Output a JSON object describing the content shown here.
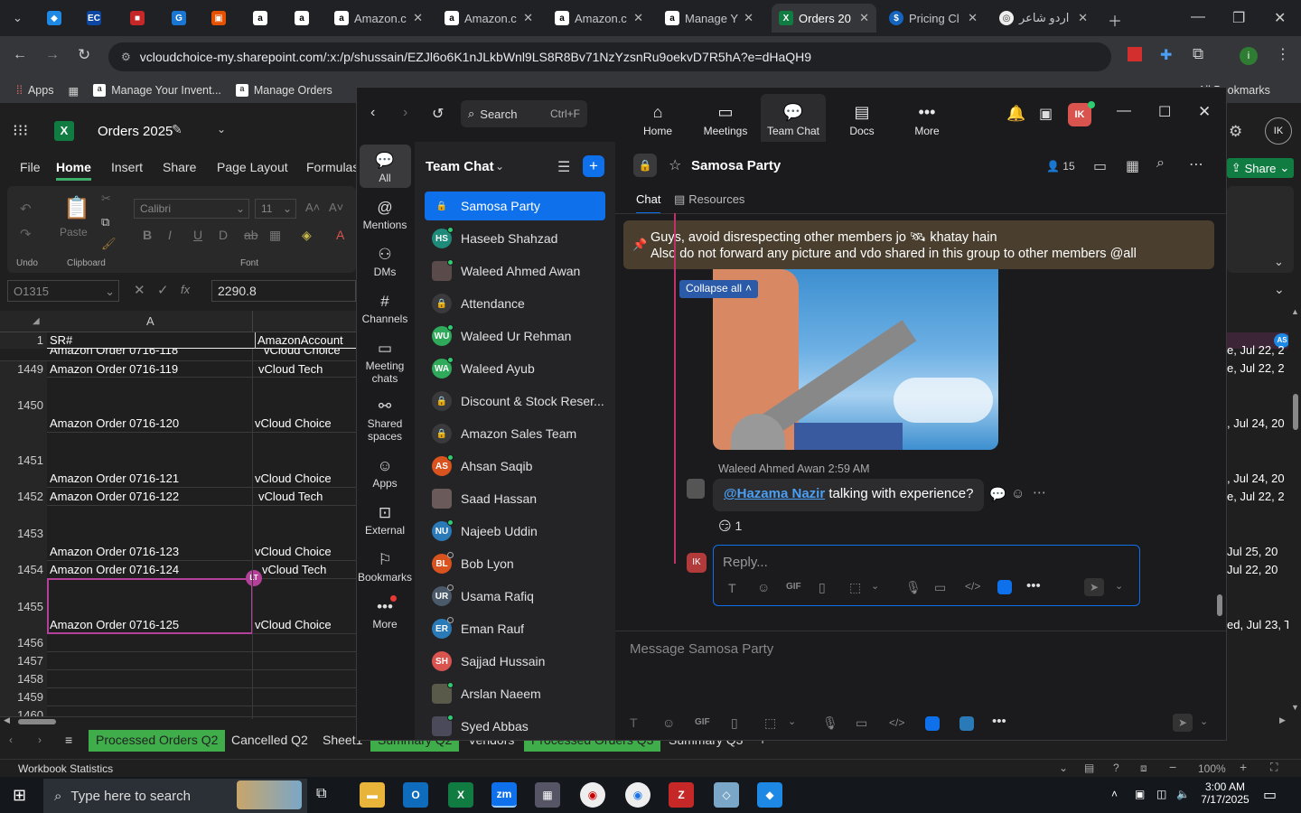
{
  "browser": {
    "tabs": [
      {
        "label": "",
        "icon": "chevron-icon"
      },
      {
        "label": "",
        "icon": "app-icon"
      },
      {
        "label": "EC",
        "icon": "ec-icon"
      },
      {
        "label": "",
        "icon": "daraz-icon"
      },
      {
        "label": "",
        "icon": "g-icon"
      },
      {
        "label": "",
        "icon": "package-icon"
      },
      {
        "label": "",
        "icon": "amazon-icon"
      },
      {
        "label": "",
        "icon": "amazon-icon"
      },
      {
        "label": "Amazon.c",
        "icon": "amazon-icon"
      },
      {
        "label": "Amazon.c",
        "icon": "amazon-icon"
      },
      {
        "label": "Amazon.c",
        "icon": "amazon-icon"
      },
      {
        "label": "Manage Y",
        "icon": "amazon-icon"
      },
      {
        "label": "Orders 20",
        "icon": "excel-icon"
      },
      {
        "label": "Pricing Cl",
        "icon": "dollar-icon"
      },
      {
        "label": "اردو شاعر",
        "icon": "web-icon"
      }
    ],
    "url": "vcloudchoice-my.sharepoint.com/:x:/p/shussain/EZJl6o6K1nJLkbWnl9LS8R8Bv71NzYzsnRu9oekvD7R5hA?e=dHaQH9",
    "bookmarks": [
      "Apps",
      "Manage Your Invent...",
      "Manage Orders",
      "All Bookmarks"
    ]
  },
  "excel": {
    "filename": "Orders 2025",
    "ribbon_tabs": [
      "File",
      "Home",
      "Insert",
      "Share",
      "Page Layout",
      "Formulas"
    ],
    "share_label": "Share",
    "font_name": "Calibri",
    "font_size": "11",
    "group_labels": {
      "undo": "Undo",
      "clipboard": "Clipboard",
      "font": "Font",
      "paste": "Paste"
    },
    "name_box": "O1315",
    "formula_value": "2290.8",
    "col_a": "A",
    "header_row": {
      "num": "1",
      "a": "SR#",
      "b": "AmazonAccount"
    },
    "rows": [
      {
        "num": "",
        "a": "Amazon Order 0716-118",
        "b": "vCloud Choice"
      },
      {
        "num": "1449",
        "a": "Amazon Order 0716-119",
        "b": "vCloud Tech"
      },
      {
        "num": "1450",
        "a": "Amazon Order 0716-120",
        "b": "vCloud Choice"
      },
      {
        "num": "1451",
        "a": "Amazon Order 0716-121",
        "b": "vCloud Choice"
      },
      {
        "num": "1452",
        "a": "Amazon Order 0716-122",
        "b": "vCloud Tech"
      },
      {
        "num": "1453",
        "a": "Amazon Order 0716-123",
        "b": "vCloud Choice"
      },
      {
        "num": "1454",
        "a": "Amazon Order 0716-124",
        "b": "vCloud Tech"
      },
      {
        "num": "1455",
        "a": "Amazon Order 0716-125",
        "b": "vCloud Choice"
      },
      {
        "num": "1456",
        "a": "",
        "b": ""
      },
      {
        "num": "1457",
        "a": "",
        "b": ""
      },
      {
        "num": "1458",
        "a": "",
        "b": ""
      },
      {
        "num": "1459",
        "a": "",
        "b": ""
      },
      {
        "num": "1460",
        "a": "",
        "b": ""
      }
    ],
    "right_dates": [
      "e, Jul 22, 2",
      "e, Jul 22, 2",
      ", Jul 24, 20",
      ", Jul 24, 20",
      "e, Jul 22, 2",
      "Jul 25, 20",
      "Jul 22, 20",
      "ed, Jul 23, Tu"
    ],
    "presence_badges": [
      "LT",
      "AS"
    ],
    "sheet_tabs": [
      "Processed Orders Q2",
      "Cancelled Q2",
      "Sheet1",
      "Summary Q2",
      "Vendors",
      "Processed Orders Q3",
      "Summary Q3"
    ],
    "status_left": "Workbook Statistics",
    "zoom_level": "100%"
  },
  "zoom": {
    "search_label": "Search",
    "search_shortcut": "Ctrl+F",
    "top_nav": [
      "Home",
      "Meetings",
      "Team Chat",
      "Docs",
      "More"
    ],
    "user_initials": "IK",
    "left_rail": [
      "All",
      "Mentions",
      "DMs",
      "Channels",
      "Meeting chats",
      "Shared spaces",
      "Apps",
      "External",
      "Bookmarks",
      "More"
    ],
    "panel_title": "Team Chat",
    "channels": [
      {
        "name": "Samosa Party",
        "type": "lock",
        "initials": "",
        "color": "",
        "status": "",
        "active": true
      },
      {
        "name": "Haseeb Shahzad",
        "type": "user",
        "initials": "HS",
        "color": "#1e8a7a",
        "status": "on"
      },
      {
        "name": "Waleed Ahmed Awan",
        "type": "photo",
        "initials": "",
        "color": "#5a4a4a",
        "status": "on"
      },
      {
        "name": "Attendance",
        "type": "lock",
        "initials": "",
        "color": "",
        "status": ""
      },
      {
        "name": "Waleed Ur Rehman",
        "type": "user",
        "initials": "WU",
        "color": "#2eaa5a",
        "status": "on"
      },
      {
        "name": "Waleed Ayub",
        "type": "user",
        "initials": "WA",
        "color": "#2eaa5a",
        "status": "on"
      },
      {
        "name": "Discount & Stock Reser...",
        "type": "lock",
        "initials": "",
        "color": "",
        "status": ""
      },
      {
        "name": "Amazon Sales Team",
        "type": "lock",
        "initials": "",
        "color": "",
        "status": ""
      },
      {
        "name": "Ahsan Saqib",
        "type": "user",
        "initials": "AS",
        "color": "#d9531e",
        "status": "on"
      },
      {
        "name": "Saad Hassan",
        "type": "photo",
        "initials": "",
        "color": "#6a5a5a",
        "status": ""
      },
      {
        "name": "Najeeb Uddin",
        "type": "user",
        "initials": "NU",
        "color": "#2a7ab8",
        "status": "on"
      },
      {
        "name": "Bob Lyon",
        "type": "user",
        "initials": "BL",
        "color": "#d9531e",
        "status": "off"
      },
      {
        "name": "Usama Rafiq",
        "type": "user",
        "initials": "UR",
        "color": "#4a5a6a",
        "status": "off"
      },
      {
        "name": "Eman Rauf",
        "type": "user",
        "initials": "ER",
        "color": "#2a7ab8",
        "status": "off"
      },
      {
        "name": "Sajjad Hussain",
        "type": "user",
        "initials": "SH",
        "color": "#d9534f",
        "status": ""
      },
      {
        "name": "Arslan Naeem",
        "type": "photo",
        "initials": "",
        "color": "#5a5a4a",
        "status": "on"
      },
      {
        "name": "Syed Abbas",
        "type": "photo",
        "initials": "",
        "color": "#4a4a5a",
        "status": "on"
      }
    ],
    "chat": {
      "title": "Samosa Party",
      "member_count": "15",
      "tabs": [
        "Chat",
        "Resources"
      ],
      "pinned_line1": "Guys, avoid disrespecting other members jo 🛰 khatay hain",
      "pinned_line2": "Also do not forward any picture and vdo shared in this group to other members @all",
      "collapse_label": "Collapse all",
      "message": {
        "sender": "Waleed Ahmed Awan",
        "time": "2:59 AM",
        "mention": "@Hazama Nazir",
        "text": " talking with experience?",
        "reaction_emoji": "😏",
        "reaction_count": "1"
      },
      "reply_placeholder": "Reply...",
      "reply_avatar": "IK",
      "composer_placeholder": "Message Samosa Party"
    }
  },
  "taskbar": {
    "search_placeholder": "Type here to search",
    "time": "3:00 AM",
    "date": "7/17/2025"
  },
  "colors": {
    "zoom_blue": "#0e71eb",
    "excel_green": "#107c41",
    "pin_banner": "#4a3f2e",
    "presence_green": "#2ecc71",
    "selection_magenta": "#b4409a"
  }
}
